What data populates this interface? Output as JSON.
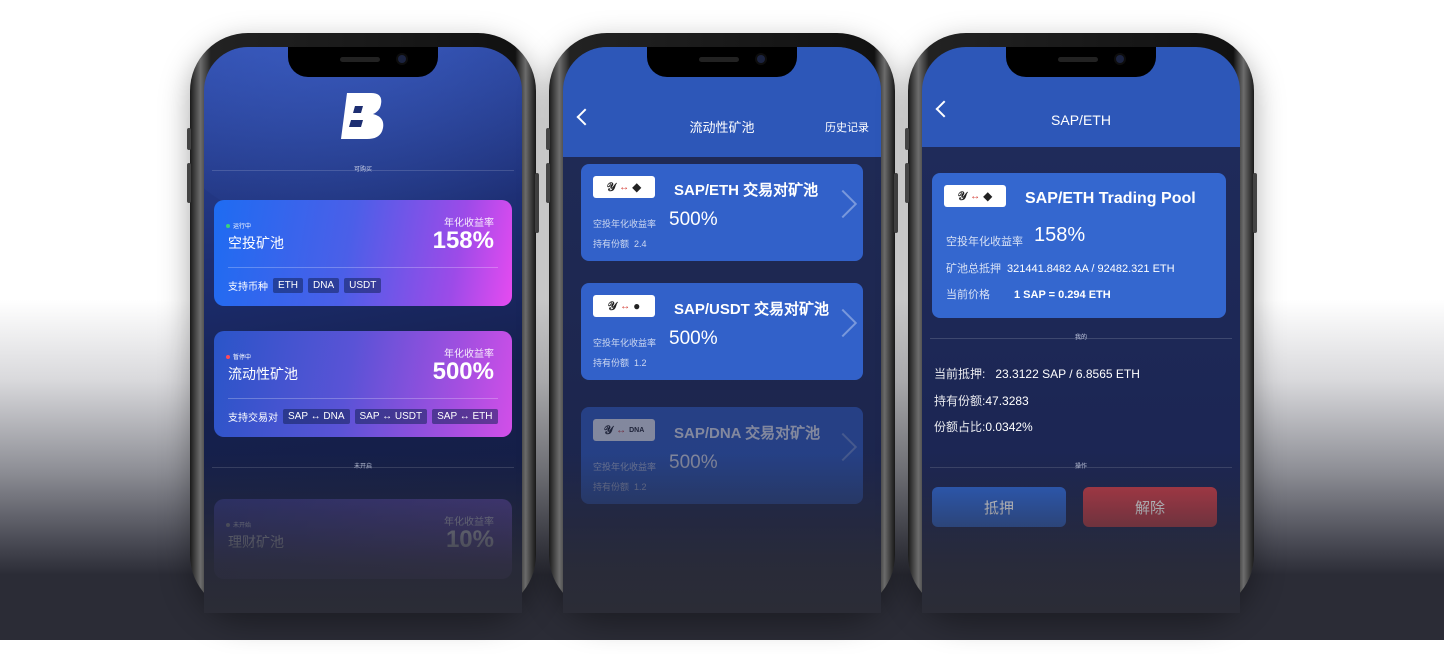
{
  "phone1": {
    "section_available": "可购买",
    "section_upcoming": "未开启",
    "cards": [
      {
        "status": "运行中",
        "status_color": "#3ad37a",
        "name": "空投矿池",
        "rate_label": "年化收益率",
        "rate": "158%",
        "support_label": "支持币种",
        "tags": [
          "ETH",
          "DNA",
          "USDT"
        ]
      },
      {
        "status": "暂停中",
        "status_color": "#ff4a5a",
        "name": "流动性矿池",
        "rate_label": "年化收益率",
        "rate": "500%",
        "support_label": "支持交易对",
        "tags": [
          "SAP ↔ DNA",
          "SAP ↔ USDT",
          "SAP ↔ ETH"
        ]
      },
      {
        "status": "未开始",
        "name": "理财矿池",
        "rate_label": "年化收益率",
        "rate": "10%"
      }
    ]
  },
  "phone2": {
    "title": "流动性矿池",
    "history": "历史记录",
    "pools": [
      {
        "name": "SAP/ETH 交易对矿池",
        "rate_label": "空投年化收益率",
        "rate": "500%",
        "hold_label": "持有份额",
        "hold": "2.4",
        "icon": "eth-icon"
      },
      {
        "name": "SAP/USDT 交易对矿池",
        "rate_label": "空投年化收益率",
        "rate": "500%",
        "hold_label": "持有份额",
        "hold": "1.2",
        "icon": "usdt-icon"
      },
      {
        "name": "SAP/DNA 交易对矿池",
        "rate_label": "空投年化收益率",
        "rate": "500%",
        "hold_label": "持有份额",
        "hold": "1.2",
        "icon": "dna-icon"
      }
    ]
  },
  "phone3": {
    "title": "SAP/ETH",
    "pool_title": "SAP/ETH Trading Pool",
    "rate_label": "空投年化收益率",
    "rate": "158%",
    "total_label": "矿池总抵押",
    "total": "321441.8482 AA / 92482.321 ETH",
    "price_label": "当前价格",
    "price": "1 SAP = 0.294 ETH",
    "section_mine": "我的",
    "current_stake_label": "当前抵押:",
    "current_stake": "23.3122 SAP / 6.8565 ETH",
    "shares_label": "持有份额:",
    "shares": "47.3283",
    "ratio_label": "份额占比:",
    "ratio": "0.0342%",
    "section_ops": "操作",
    "stake_button": "抵押",
    "unlock_button": "解除"
  }
}
